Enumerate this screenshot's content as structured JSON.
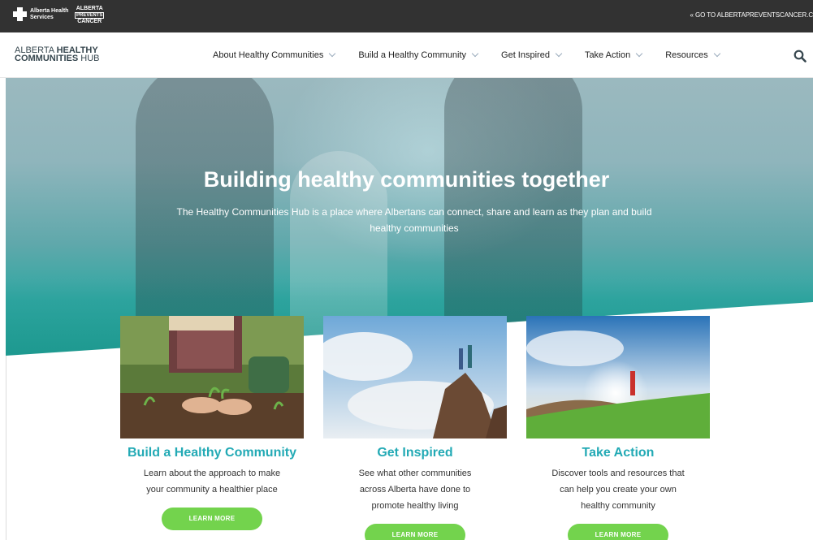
{
  "topbar": {
    "ahs_logo_text": "Alberta Health Services",
    "apc_logo": {
      "top": "ALBERTA",
      "mid": "PREVENTS",
      "bottom": "CANCER"
    },
    "goto_link": "« GO TO ALBERTAPREVENTSCANCER.C"
  },
  "header": {
    "logo_line1_light": "ALBERTA ",
    "logo_line1_bold": "HEALTHY",
    "logo_line2_bold": "COMMUNITIES",
    "logo_line2_light": " HUB",
    "nav": [
      {
        "label": "About Healthy Communities"
      },
      {
        "label": "Build a Healthy Community"
      },
      {
        "label": "Get Inspired"
      },
      {
        "label": "Take Action"
      },
      {
        "label": "Resources"
      }
    ]
  },
  "hero": {
    "title": "Building healthy communities together",
    "subtitle": "The Healthy Communities Hub is a place where Albertans can connect, share and learn as they plan and build healthy communities"
  },
  "cards": [
    {
      "title": "Build a Healthy Community",
      "description": "Learn about the approach to make your community a healthier place",
      "button": "LEARN MORE"
    },
    {
      "title": "Get Inspired",
      "description": "See what other communities across Alberta have done to promote healthy living",
      "button": "LEARN MORE"
    },
    {
      "title": "Take Action",
      "description": "Discover tools and resources that can help you create your own healthy community",
      "button": "LEARN MORE"
    }
  ],
  "colors": {
    "topbar": "#323232",
    "accent_teal": "#23aab5",
    "button_green": "#73d34d",
    "hero_teal": "#22a89f"
  }
}
